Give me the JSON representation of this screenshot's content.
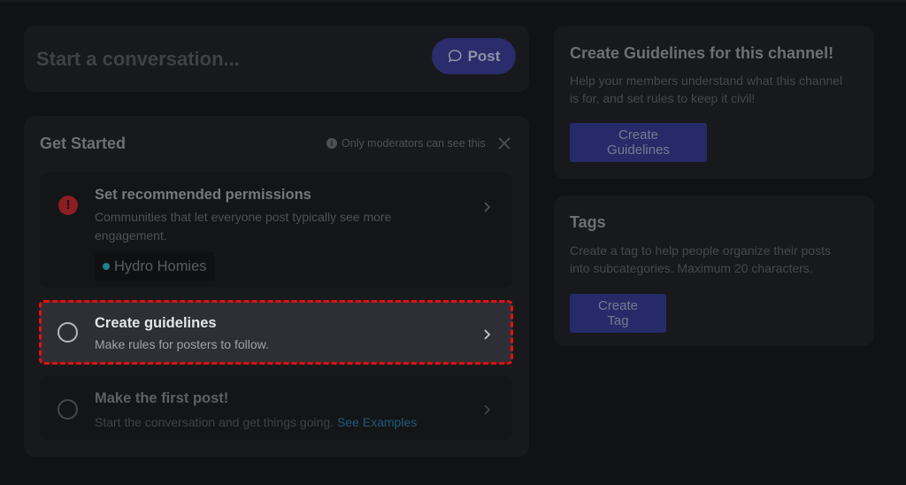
{
  "composer": {
    "placeholder": "Start a conversation...",
    "post_label": "Post",
    "post_icon": "chat-bubble-icon"
  },
  "get_started": {
    "title": "Get Started",
    "visibility_note": "Only moderators can see this",
    "note_icon": "info-icon",
    "close_icon": "close-icon",
    "tasks": [
      {
        "title": "Set recommended permissions",
        "description": "Communities that let everyone post typically see more engagement.",
        "status_icon": "alert-icon",
        "channel_chip": "Hydro Homies",
        "channel_dot_color": "#1f7f8a"
      },
      {
        "title": "Create guidelines",
        "description": "Make rules for posters to follow.",
        "status_icon": "empty-circle-icon",
        "highlighted": true,
        "highlight_color": "#e60f0f"
      },
      {
        "title": "Make the first post!",
        "description": "Start the conversation and get things going.",
        "link": "See Examples",
        "status_icon": "empty-circle-icon"
      }
    ]
  },
  "guidelines_card": {
    "title": "Create Guidelines for this channel!",
    "description": "Help your members understand what this channel is for, and set rules to keep it civil!",
    "button_label": "Create Guidelines"
  },
  "tags_card": {
    "title": "Tags",
    "description": "Create a tag to help people organize their posts into subcategories. Maximum 20 characters.",
    "button_label": "Create Tag"
  },
  "colors": {
    "background": "#111214",
    "panel": "#18191c",
    "accent": "#272a68",
    "alert": "#8a1e21",
    "link": "#1d5b7c"
  }
}
